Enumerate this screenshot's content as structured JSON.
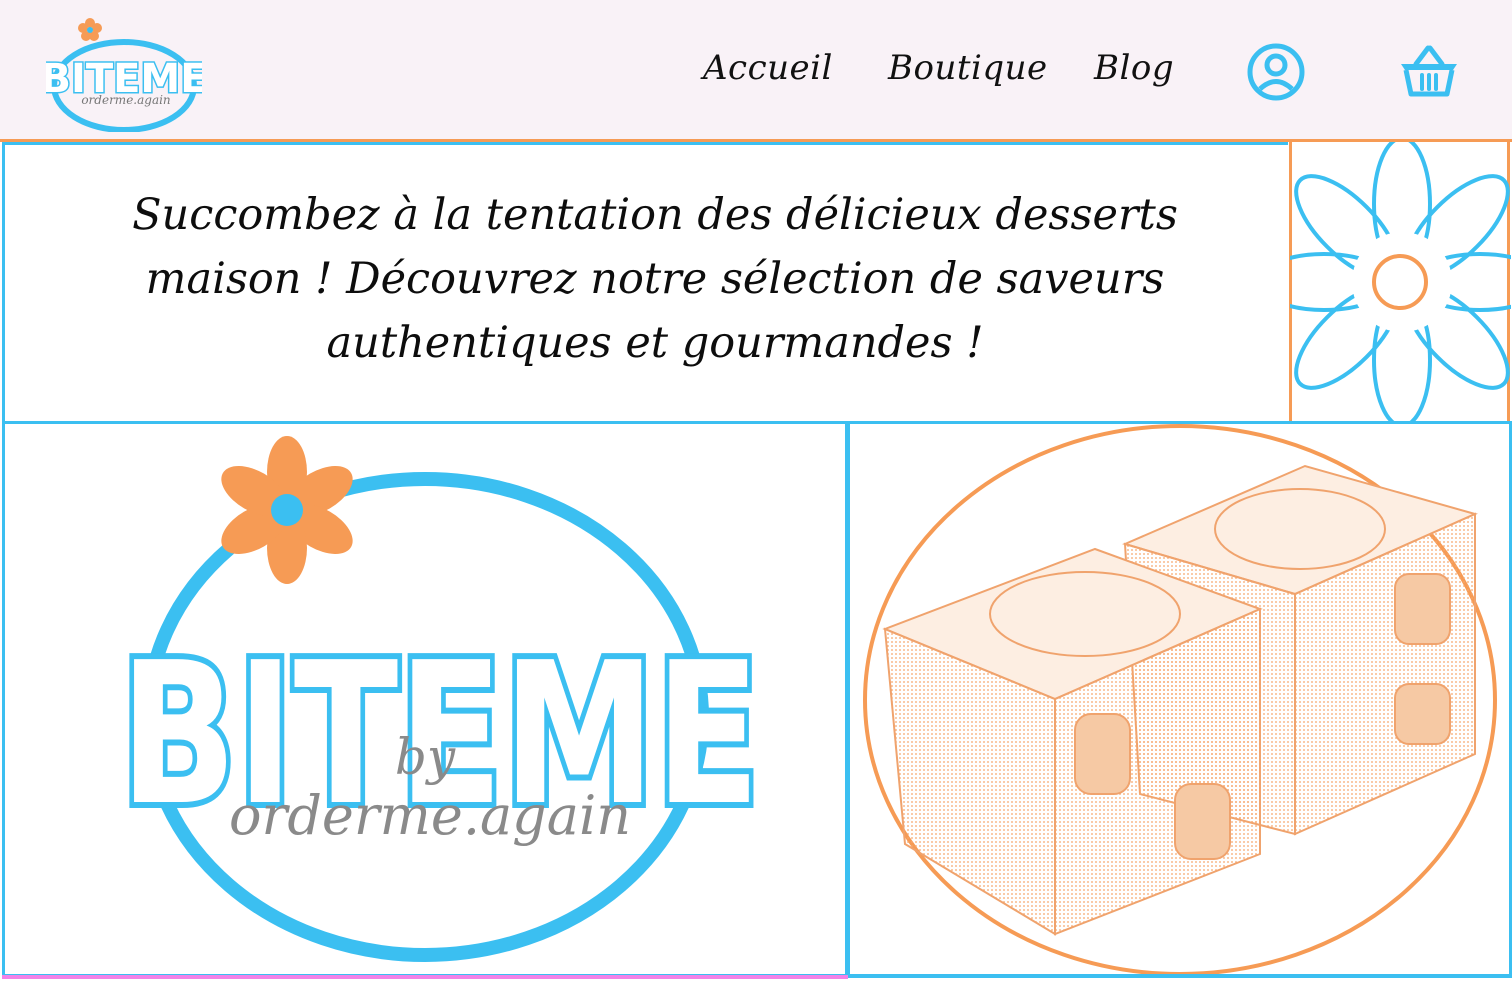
{
  "brand": {
    "name": "BITEME",
    "tagline_by": "by",
    "tagline_handle": "orderme.again"
  },
  "nav": {
    "items": [
      {
        "label": "Accueil"
      },
      {
        "label": "Boutique"
      },
      {
        "label": "Blog"
      }
    ]
  },
  "hero": {
    "text": "Succombez à la tentation des délicieux desserts maison ! Découvrez notre sélection de saveurs authentiques et gourmandes !"
  },
  "colors": {
    "blue": "#3bbff1",
    "orange": "#f69b55",
    "pink": "#f283e8",
    "header_bg": "#f9f2f7"
  },
  "icons": {
    "account": "user-circle-icon",
    "cart": "shopping-basket-icon",
    "decor": "daisy-flower-icon"
  }
}
